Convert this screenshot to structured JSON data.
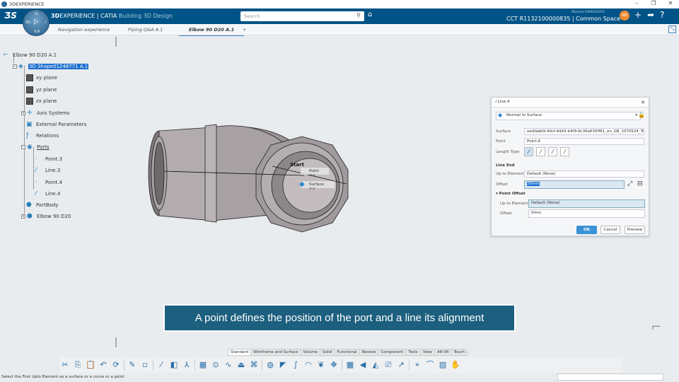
{
  "window": {
    "title": "3DEXPERIENCE",
    "controls": [
      "–",
      "❐",
      "✕"
    ]
  },
  "topbar": {
    "brand_bold": "3D",
    "brand_rest": "EXPERIENCE | CATIA",
    "app": "Building 3D Design",
    "search_placeholder": "Search",
    "user": "Maxime RAMACKERS",
    "avatar_initials": "MR",
    "space": "CCT R1132100000835 | Common Space ⌄",
    "compass": {
      "top": "V₃",
      "left": "3D",
      "right": "i",
      "bottom": "V,R"
    }
  },
  "tabs": [
    {
      "label": "Navigation experience"
    },
    {
      "label": "Piping Q&A A.1"
    },
    {
      "label": "Elbow 90 D20 A.1",
      "active": true
    },
    {
      "label": "+"
    }
  ],
  "tree": [
    {
      "label": "Elbow 90 D20 A.1",
      "icon": "elbow-icon"
    },
    {
      "label": "3D Shape01248771 A.1",
      "icon": "shape-icon",
      "selected": true
    },
    {
      "label": "xy plane",
      "icon": "plane-icon"
    },
    {
      "label": "yz plane",
      "icon": "plane-icon"
    },
    {
      "label": "zx plane",
      "icon": "plane-icon"
    },
    {
      "label": "Axis Systems",
      "icon": "axis-icon"
    },
    {
      "label": "External Parameters",
      "icon": "parameters-icon"
    },
    {
      "label": "Relations",
      "icon": "relations-icon"
    },
    {
      "label": "Ports",
      "icon": "ports-icon"
    },
    {
      "label": "Point.3",
      "icon": "point-icon"
    },
    {
      "label": "Line.3",
      "icon": "line-icon"
    },
    {
      "label": "Point.4",
      "icon": "point-icon"
    },
    {
      "label": "Line.4",
      "icon": "line-icon"
    },
    {
      "label": "PartBody",
      "icon": "body-icon"
    },
    {
      "label": "Elbow 90 D20",
      "icon": "body-icon"
    }
  ],
  "viewport": {
    "start_label": "Start",
    "menu": [
      "Point >>",
      "Surface >>"
    ]
  },
  "dialog": {
    "title": "Line.4",
    "type": "Normal to Surface",
    "surface_label": "Surface",
    "surface_value": "eedfabb9-49cf-4d43-b4f9-9c36a635ff61_en_GB_1070524_Tru...",
    "point_label": "Point",
    "point_value": "Point.4",
    "length_type_label": "Length Type",
    "line_end": "Line End",
    "upto_label": "Up-to Element",
    "upto_value": "Default (None)",
    "offset_label": "Offset",
    "offset_value": "20mm",
    "point_offset": "▾ Point Offset",
    "po_upto_label": "Up-to Element",
    "po_upto_value": "Default (None)",
    "po_offset_label": "Offset",
    "po_offset_value": "0mm",
    "ok": "OK",
    "cancel": "Cancel",
    "preview": "Preview"
  },
  "caption": "A point defines the position of the port and a line its alignment",
  "action_tabs": [
    "Standard",
    "Wireframe and Surface",
    "Volume",
    "Solid",
    "Functional",
    "Review",
    "Component",
    "Tools",
    "View",
    "AR-VR",
    "Touch"
  ],
  "toolbar_icons": [
    "cut-icon",
    "copy-icon",
    "paste-icon",
    "undo-icon",
    "update-icon",
    "sketch-icon",
    "point-icon",
    "line-icon",
    "plane-icon",
    "axis-icon",
    "grid-icon",
    "circle-icon",
    "spline-icon",
    "sweep-icon",
    "extrude-icon",
    "revolve-icon",
    "fill-icon",
    "blend-icon",
    "surface-icon",
    "loft-icon",
    "pattern-icon",
    "mesh-icon",
    "transform-icon",
    "split-icon",
    "analysis-icon",
    "measure-icon",
    "compass-icon",
    "law-icon",
    "texture-icon",
    "hand-icon"
  ],
  "status": "Select the First Upto Element as a surface or a curve or a point",
  "colors": {
    "topbar": "#005386",
    "selection": "#1a6fcf",
    "caption": "#1c5f7e",
    "ok": "#3a93d6"
  }
}
